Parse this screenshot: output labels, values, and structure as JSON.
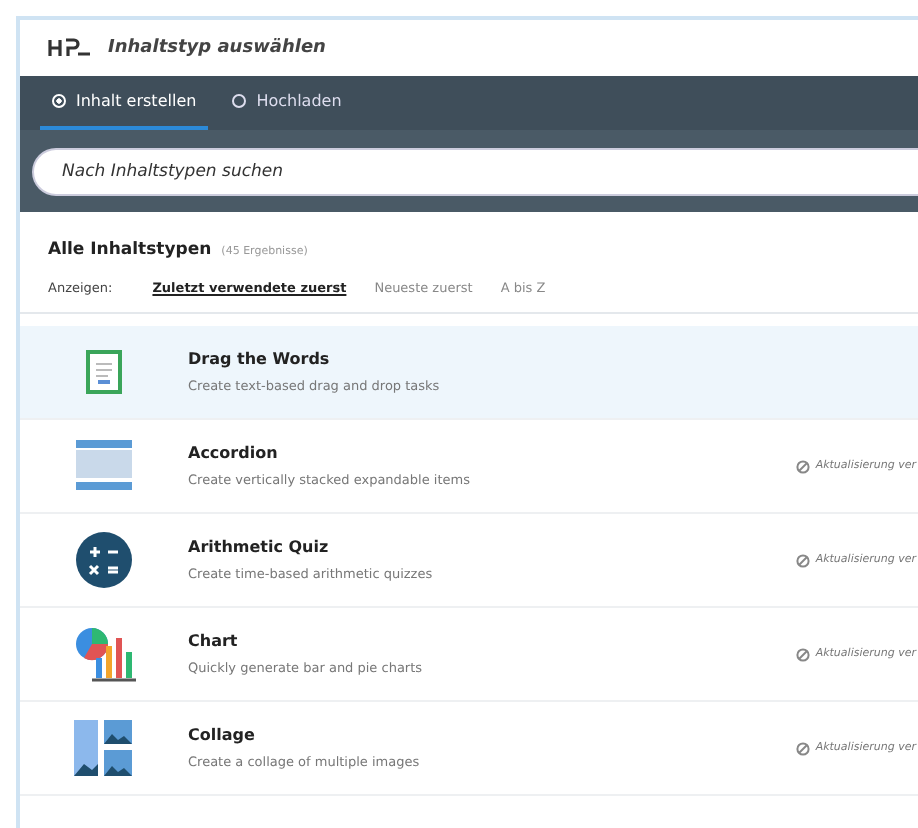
{
  "window": {
    "title": "Inhaltstyp auswählen"
  },
  "tabs": [
    {
      "label": "Inhalt erstellen",
      "selected": true
    },
    {
      "label": "Hochladen",
      "selected": false
    }
  ],
  "search": {
    "placeholder": "Nach Inhaltstypen suchen"
  },
  "list_header": {
    "title": "Alle Inhaltstypen",
    "count": "(45 Ergebnisse)"
  },
  "sort": {
    "label": "Anzeigen:",
    "options": [
      {
        "label": "Zuletzt verwendete zuerst",
        "selected": true
      },
      {
        "label": "Neueste zuerst",
        "selected": false
      },
      {
        "label": "A bis Z",
        "selected": false
      }
    ]
  },
  "content_types": [
    {
      "kind": "drag",
      "title": "Drag the Words",
      "description": "Create text-based drag and drop tasks",
      "selected": true
    },
    {
      "kind": "accordion",
      "title": "Accordion",
      "description": "Create vertically stacked expandable items",
      "selected": false,
      "update": "Aktualisierung ver"
    },
    {
      "kind": "arithmetic",
      "title": "Arithmetic Quiz",
      "description": "Create time-based arithmetic quizzes",
      "selected": false,
      "update": "Aktualisierung ver"
    },
    {
      "kind": "chart",
      "title": "Chart",
      "description": "Quickly generate bar and pie charts",
      "selected": false,
      "update": "Aktualisierung ver"
    },
    {
      "kind": "collage",
      "title": "Collage",
      "description": "Create a collage of multiple images",
      "selected": false,
      "update": "Aktualisierung ver"
    }
  ]
}
